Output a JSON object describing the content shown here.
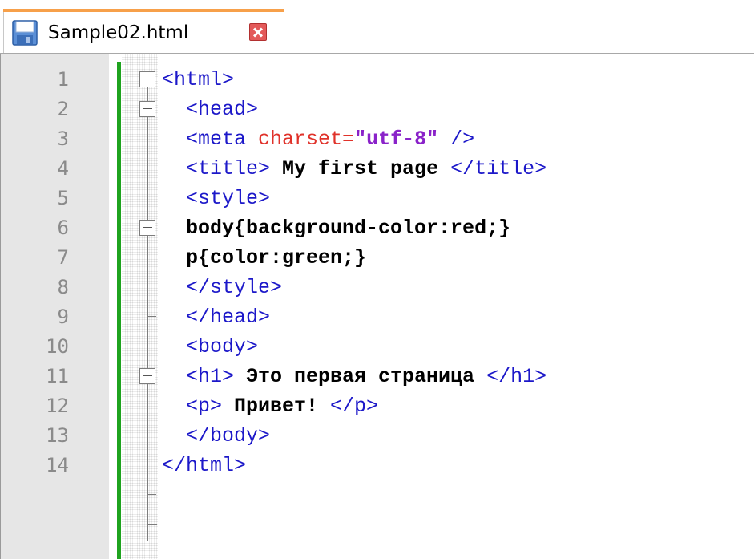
{
  "tab": {
    "filename": "Sample02.html",
    "icon": "save-disk-icon",
    "close_icon": "close-icon",
    "accent_color": "#f7a04a"
  },
  "editor": {
    "line_numbers": [
      "1",
      "2",
      "3",
      "4",
      "5",
      "6",
      "7",
      "8",
      "9",
      "10",
      "11",
      "12",
      "13",
      "14"
    ],
    "lines": [
      [
        {
          "t": "tag",
          "v": "<html>"
        }
      ],
      [
        {
          "t": "tag",
          "v": "  <head>"
        }
      ],
      [
        {
          "t": "tag",
          "v": "  <meta "
        },
        {
          "t": "attr",
          "v": "charset="
        },
        {
          "t": "val",
          "v": "\"utf-8\""
        },
        {
          "t": "tag",
          "v": " />"
        }
      ],
      [
        {
          "t": "tag",
          "v": "  <title>"
        },
        {
          "t": "txt",
          "v": " My first page "
        },
        {
          "t": "tag",
          "v": "</title>"
        }
      ],
      [
        {
          "t": "tag",
          "v": "  <style>"
        }
      ],
      [
        {
          "t": "txt",
          "v": "  body{background-color:red;}"
        }
      ],
      [
        {
          "t": "txt",
          "v": "  p{color:green;}"
        }
      ],
      [
        {
          "t": "tag",
          "v": "  </style>"
        }
      ],
      [
        {
          "t": "tag",
          "v": "  </head>"
        }
      ],
      [
        {
          "t": "tag",
          "v": "  <body>"
        }
      ],
      [
        {
          "t": "tag",
          "v": "  <h1>"
        },
        {
          "t": "txt",
          "v": " Это первая страница "
        },
        {
          "t": "tag",
          "v": "</h1>"
        }
      ],
      [
        {
          "t": "tag",
          "v": "  <p>"
        },
        {
          "t": "txt",
          "v": " Привет! "
        },
        {
          "t": "tag",
          "v": "</p>"
        }
      ],
      [
        {
          "t": "tag",
          "v": "  </body>"
        }
      ],
      [
        {
          "t": "tag",
          "v": "</html>"
        }
      ]
    ],
    "colors": {
      "tag": "#1c18c9",
      "attr": "#e0322a",
      "value": "#8a22c9",
      "text": "#000000",
      "change_bar": "#1fa31f"
    }
  }
}
